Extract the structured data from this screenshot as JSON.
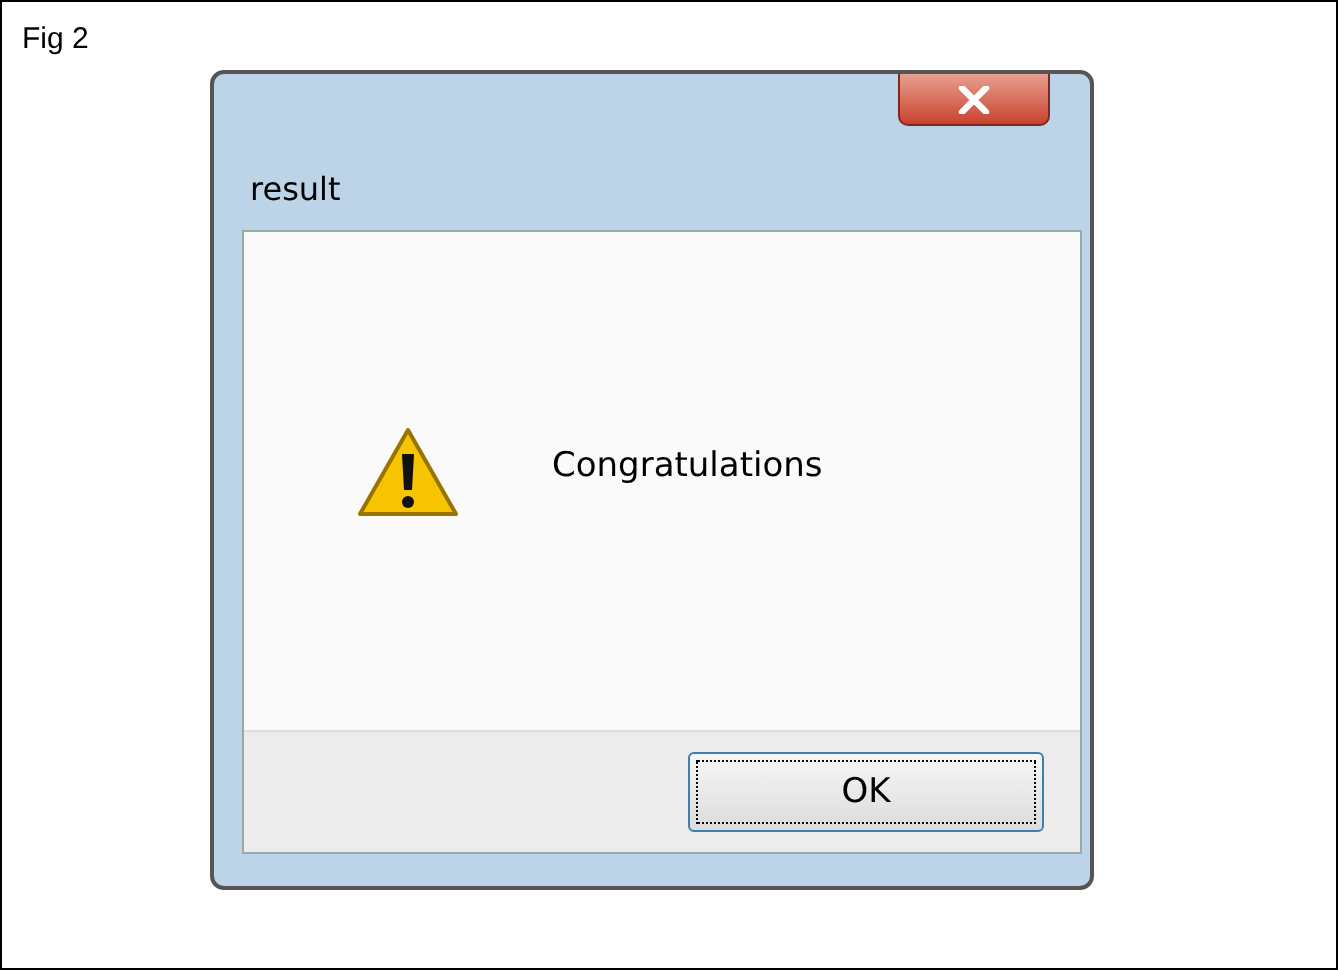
{
  "figure": {
    "caption": "Fig 2"
  },
  "dialog": {
    "title": "result",
    "message": "Congratulations",
    "kind": "warning",
    "buttons": [
      {
        "label": "OK",
        "focused": true
      }
    ]
  }
}
